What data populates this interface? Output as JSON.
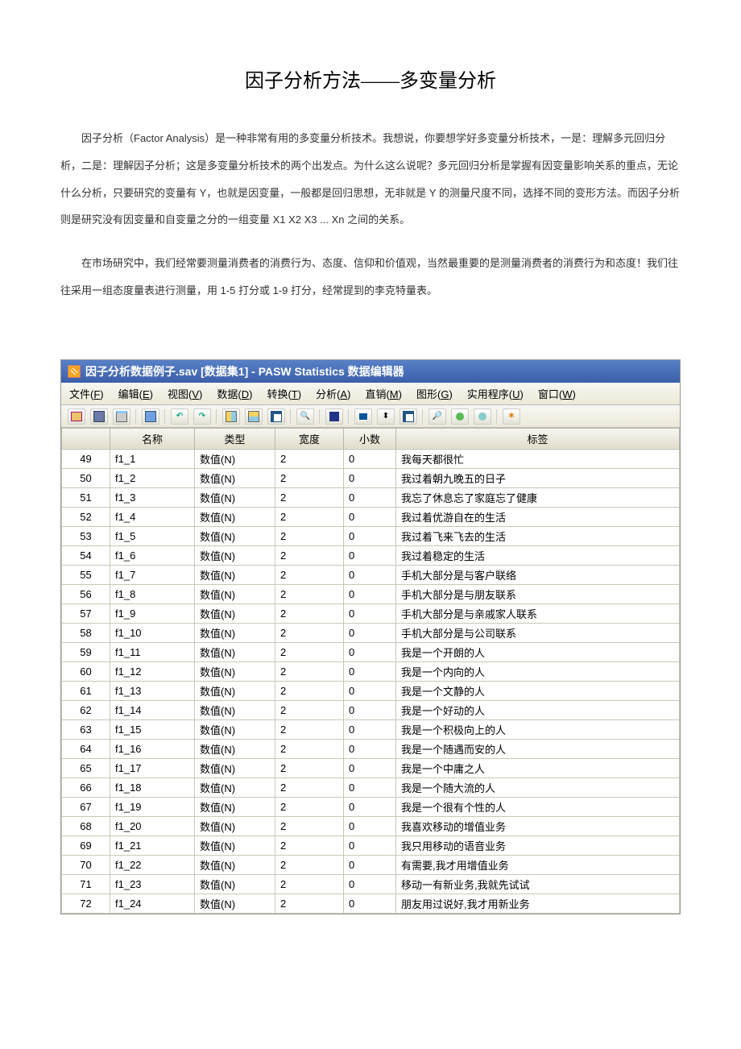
{
  "document": {
    "title": "因子分析方法——多变量分析",
    "p1": "因子分析（Factor Analysis）是一种非常有用的多变量分析技术。我想说，你要想学好多变量分析技术，一是：理解多元回归分析，二是：理解因子分析；这是多变量分析技术的两个出发点。为什么这么说呢？多元回归分析是掌握有因变量影响关系的重点，无论什么分析，只要研究的变量有 Y，也就是因变量，一般都是回归思想，无非就是 Y 的测量尺度不同，选择不同的变形方法。而因子分析则是研究没有因变量和自变量之分的一组变量 X1 X2 X3 ... Xn 之间的关系。",
    "p2": "在市场研究中，我们经常要测量消费者的消费行为、态度、信仰和价值观，当然最重要的是测量消费者的消费行为和态度！我们往往采用一组态度量表进行测量，用 1-5 打分或 1-9 打分，经常提到的李克特量表。"
  },
  "spss": {
    "window_title": "因子分析数据例子.sav [数据集1] - PASW Statistics 数据编辑器",
    "menu": [
      {
        "label": "文件",
        "m": "F"
      },
      {
        "label": "编辑",
        "m": "E"
      },
      {
        "label": "视图",
        "m": "V"
      },
      {
        "label": "数据",
        "m": "D"
      },
      {
        "label": "转换",
        "m": "T"
      },
      {
        "label": "分析",
        "m": "A"
      },
      {
        "label": "直销",
        "m": "M"
      },
      {
        "label": "图形",
        "m": "G"
      },
      {
        "label": "实用程序",
        "m": "U"
      },
      {
        "label": "窗口",
        "m": "W"
      }
    ],
    "columns": {
      "name": "名称",
      "type": "类型",
      "width": "宽度",
      "decimals": "小数",
      "label": "标签"
    },
    "type_value": "数值(N)",
    "width_value": "2",
    "dec_value": "0",
    "rows": [
      {
        "n": 49,
        "name": "f1_1",
        "label": "我每天都很忙"
      },
      {
        "n": 50,
        "name": "f1_2",
        "label": "我过着朝九晚五的日子"
      },
      {
        "n": 51,
        "name": "f1_3",
        "label": "我忘了休息忘了家庭忘了健康"
      },
      {
        "n": 52,
        "name": "f1_4",
        "label": "我过着优游自在的生活"
      },
      {
        "n": 53,
        "name": "f1_5",
        "label": "我过着飞来飞去的生活"
      },
      {
        "n": 54,
        "name": "f1_6",
        "label": "我过着稳定的生活"
      },
      {
        "n": 55,
        "name": "f1_7",
        "label": "手机大部分是与客户联络"
      },
      {
        "n": 56,
        "name": "f1_8",
        "label": "手机大部分是与朋友联系"
      },
      {
        "n": 57,
        "name": "f1_9",
        "label": "手机大部分是与亲戚家人联系"
      },
      {
        "n": 58,
        "name": "f1_10",
        "label": "手机大部分是与公司联系"
      },
      {
        "n": 59,
        "name": "f1_11",
        "label": "我是一个开朗的人"
      },
      {
        "n": 60,
        "name": "f1_12",
        "label": "我是一个内向的人"
      },
      {
        "n": 61,
        "name": "f1_13",
        "label": "我是一个文静的人"
      },
      {
        "n": 62,
        "name": "f1_14",
        "label": "我是一个好动的人"
      },
      {
        "n": 63,
        "name": "f1_15",
        "label": "我是一个积极向上的人"
      },
      {
        "n": 64,
        "name": "f1_16",
        "label": "我是一个随遇而安的人"
      },
      {
        "n": 65,
        "name": "f1_17",
        "label": "我是一个中庸之人"
      },
      {
        "n": 66,
        "name": "f1_18",
        "label": "我是一个随大流的人"
      },
      {
        "n": 67,
        "name": "f1_19",
        "label": "我是一个很有个性的人"
      },
      {
        "n": 68,
        "name": "f1_20",
        "label": "我喜欢移动的增值业务"
      },
      {
        "n": 69,
        "name": "f1_21",
        "label": "我只用移动的语音业务"
      },
      {
        "n": 70,
        "name": "f1_22",
        "label": "有需要,我才用增值业务"
      },
      {
        "n": 71,
        "name": "f1_23",
        "label": "移动一有新业务,我就先试试"
      },
      {
        "n": 72,
        "name": "f1_24",
        "label": "朋友用过说好,我才用新业务"
      }
    ]
  }
}
